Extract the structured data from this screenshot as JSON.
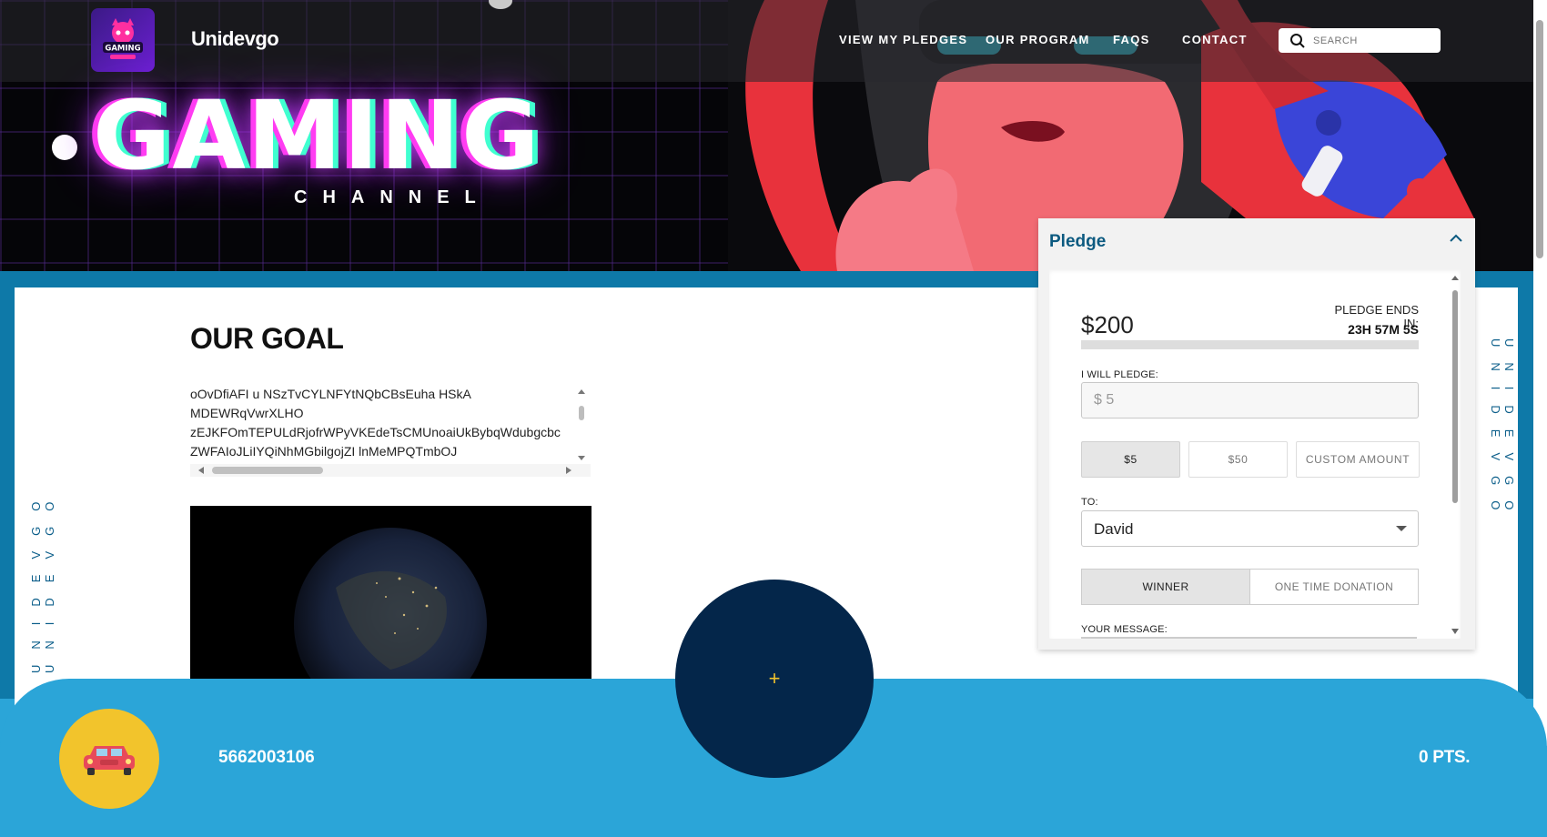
{
  "header": {
    "brand": "Unidevgo",
    "logo_text": "GAMING",
    "nav": [
      "VIEW MY PLEDGES",
      "OUR PROGRAM",
      "FAQS",
      "CONTACT"
    ],
    "search_placeholder": "SEARCH"
  },
  "hero": {
    "title": "GAMING",
    "subtitle": "CHANNEL"
  },
  "side_text": "UNIDEVGO UNIDEVGO",
  "goal": {
    "title": "OUR GOAL",
    "lines": [
      "oOvDfiAFI u NSzTvCYLNFYtNQbCBsEuha HSkA",
      "MDEWRqVwrXLHO",
      "zEJKFOmTEPULdRjofrWPyVKEdeTsCMUnoaiUkBybqWdubgcbc",
      "ZWFAIoJLiIYQiNhMGbilgojZI lnMeMPQTmbOJ"
    ]
  },
  "pledge": {
    "header": "Pledge",
    "amount": "$200",
    "ends_label": "PLEDGE ENDS IN:",
    "ends_time": "23H 57M 5S",
    "progress": 0,
    "will_pledge_label": "I WILL PLEDGE:",
    "input_value": "$  5",
    "amount_buttons": [
      "$5",
      "$50",
      "CUSTOM AMOUNT"
    ],
    "to_label": "TO:",
    "to_value": "David",
    "toggle": [
      "WINNER",
      "ONE TIME DONATION"
    ],
    "message_label": "YOUR MESSAGE:"
  },
  "footer": {
    "phone": "5662003106",
    "points": "0 PTS.",
    "fab_label": "+"
  },
  "colors": {
    "accent": "#2ba5d8",
    "dark_navy": "#04264a",
    "pledge_title": "#0c5a80",
    "gold": "#f2c42c"
  }
}
